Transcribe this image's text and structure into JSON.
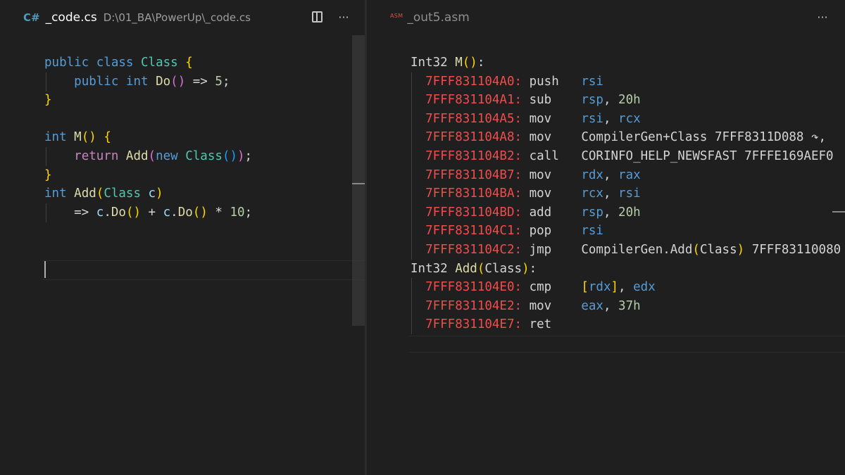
{
  "left_pane": {
    "tab": {
      "icon": "csharp-icon",
      "icon_glyph": "C#",
      "name": "_code.cs",
      "path": "D:\\01_BA\\PowerUp\\_code.cs"
    },
    "actions": {
      "split_icon": "split-editor-icon",
      "more": "···"
    },
    "code_lines": [
      [
        [
          "kw",
          "public"
        ],
        [
          "txt",
          " "
        ],
        [
          "kw",
          "class"
        ],
        [
          "txt",
          " "
        ],
        [
          "cls",
          "Class"
        ],
        [
          "txt",
          " "
        ],
        [
          "b1",
          "{"
        ]
      ],
      [
        [
          "txt",
          "    "
        ],
        [
          "kw",
          "public"
        ],
        [
          "txt",
          " "
        ],
        [
          "kw",
          "int"
        ],
        [
          "txt",
          " "
        ],
        [
          "fn",
          "Do"
        ],
        [
          "b2",
          "()"
        ],
        [
          "txt",
          " => "
        ],
        [
          "num",
          "5"
        ],
        [
          "txt",
          ";"
        ]
      ],
      [
        [
          "b1",
          "}"
        ]
      ],
      [],
      [
        [
          "kw",
          "int"
        ],
        [
          "txt",
          " "
        ],
        [
          "fn",
          "M"
        ],
        [
          "b1",
          "()"
        ],
        [
          "txt",
          " "
        ],
        [
          "b1",
          "{"
        ]
      ],
      [
        [
          "txt",
          "    "
        ],
        [
          "ret",
          "return"
        ],
        [
          "txt",
          " "
        ],
        [
          "fn",
          "Add"
        ],
        [
          "b2",
          "("
        ],
        [
          "kw",
          "new"
        ],
        [
          "txt",
          " "
        ],
        [
          "cls",
          "Class"
        ],
        [
          "b3",
          "()"
        ],
        [
          "b2",
          ")"
        ],
        [
          "txt",
          ";"
        ]
      ],
      [
        [
          "b1",
          "}"
        ]
      ],
      [
        [
          "kw",
          "int"
        ],
        [
          "txt",
          " "
        ],
        [
          "fn",
          "Add"
        ],
        [
          "b1",
          "("
        ],
        [
          "cls",
          "Class"
        ],
        [
          "txt",
          " "
        ],
        [
          "param",
          "c"
        ],
        [
          "b1",
          ")"
        ]
      ],
      [
        [
          "txt",
          "    => "
        ],
        [
          "param",
          "c"
        ],
        [
          "txt",
          "."
        ],
        [
          "fn",
          "Do"
        ],
        [
          "b1",
          "()"
        ],
        [
          "txt",
          " + "
        ],
        [
          "param",
          "c"
        ],
        [
          "txt",
          "."
        ],
        [
          "fn",
          "Do"
        ],
        [
          "b1",
          "()"
        ],
        [
          "txt",
          " * "
        ],
        [
          "num",
          "10"
        ],
        [
          "txt",
          ";"
        ]
      ]
    ]
  },
  "right_pane": {
    "tab": {
      "icon": "asm-icon",
      "icon_label": "ASM",
      "name": "_out5.asm"
    },
    "actions": {
      "more": "···"
    },
    "code_lines": [
      [
        [
          "txt",
          "Int32 "
        ],
        [
          "fn",
          "M"
        ],
        [
          "b1",
          "()"
        ],
        [
          "txt",
          ":"
        ]
      ],
      [
        [
          "txt",
          "  "
        ],
        [
          "addr",
          "7FFF831104A0:"
        ],
        [
          "mn",
          " push   "
        ],
        [
          "reg",
          "rsi"
        ]
      ],
      [
        [
          "txt",
          "  "
        ],
        [
          "addr",
          "7FFF831104A1:"
        ],
        [
          "mn",
          " sub    "
        ],
        [
          "reg",
          "rsp"
        ],
        [
          "txt",
          ", "
        ],
        [
          "num",
          "20h"
        ]
      ],
      [
        [
          "txt",
          "  "
        ],
        [
          "addr",
          "7FFF831104A5:"
        ],
        [
          "mn",
          " mov    "
        ],
        [
          "reg",
          "rsi"
        ],
        [
          "txt",
          ", "
        ],
        [
          "reg",
          "rcx"
        ]
      ],
      [
        [
          "txt",
          "  "
        ],
        [
          "addr",
          "7FFF831104A8:"
        ],
        [
          "mn",
          " mov    "
        ],
        [
          "txt",
          "CompilerGen+Class 7FFF8311D088 ↷,"
        ]
      ],
      [
        [
          "txt",
          "  "
        ],
        [
          "addr",
          "7FFF831104B2:"
        ],
        [
          "mn",
          " call   "
        ],
        [
          "txt",
          "CORINFO_HELP_NEWSFAST 7FFFE169AEF0"
        ]
      ],
      [
        [
          "txt",
          "  "
        ],
        [
          "addr",
          "7FFF831104B7:"
        ],
        [
          "mn",
          " mov    "
        ],
        [
          "reg",
          "rdx"
        ],
        [
          "txt",
          ", "
        ],
        [
          "reg",
          "rax"
        ]
      ],
      [
        [
          "txt",
          "  "
        ],
        [
          "addr",
          "7FFF831104BA:"
        ],
        [
          "mn",
          " mov    "
        ],
        [
          "reg",
          "rcx"
        ],
        [
          "txt",
          ", "
        ],
        [
          "reg",
          "rsi"
        ]
      ],
      [
        [
          "txt",
          "  "
        ],
        [
          "addr",
          "7FFF831104BD:"
        ],
        [
          "mn",
          " add    "
        ],
        [
          "reg",
          "rsp"
        ],
        [
          "txt",
          ", "
        ],
        [
          "num",
          "20h"
        ]
      ],
      [
        [
          "txt",
          "  "
        ],
        [
          "addr",
          "7FFF831104C1:"
        ],
        [
          "mn",
          " pop    "
        ],
        [
          "reg",
          "rsi"
        ]
      ],
      [
        [
          "txt",
          "  "
        ],
        [
          "addr",
          "7FFF831104C2:"
        ],
        [
          "mn",
          " jmp    "
        ],
        [
          "txt",
          "CompilerGen.Add"
        ],
        [
          "b1",
          "("
        ],
        [
          "txt",
          "Class"
        ],
        [
          "b1",
          ")"
        ],
        [
          "txt",
          " 7FFF83110080"
        ]
      ],
      [
        [
          "txt",
          "Int32 "
        ],
        [
          "fn",
          "Add"
        ],
        [
          "b1",
          "("
        ],
        [
          "txt",
          "Class"
        ],
        [
          "b1",
          ")"
        ],
        [
          "txt",
          ":"
        ]
      ],
      [
        [
          "txt",
          "  "
        ],
        [
          "addr",
          "7FFF831104E0:"
        ],
        [
          "mn",
          " cmp    "
        ],
        [
          "b1",
          "["
        ],
        [
          "reg",
          "rdx"
        ],
        [
          "b1",
          "]"
        ],
        [
          "txt",
          ", "
        ],
        [
          "reg",
          "edx"
        ]
      ],
      [
        [
          "txt",
          "  "
        ],
        [
          "addr",
          "7FFF831104E2:"
        ],
        [
          "mn",
          " mov    "
        ],
        [
          "reg",
          "eax"
        ],
        [
          "txt",
          ", "
        ],
        [
          "num",
          "37h"
        ]
      ],
      [
        [
          "txt",
          "  "
        ],
        [
          "addr",
          "7FFF831104E7:"
        ],
        [
          "mn",
          " ret"
        ]
      ]
    ]
  }
}
